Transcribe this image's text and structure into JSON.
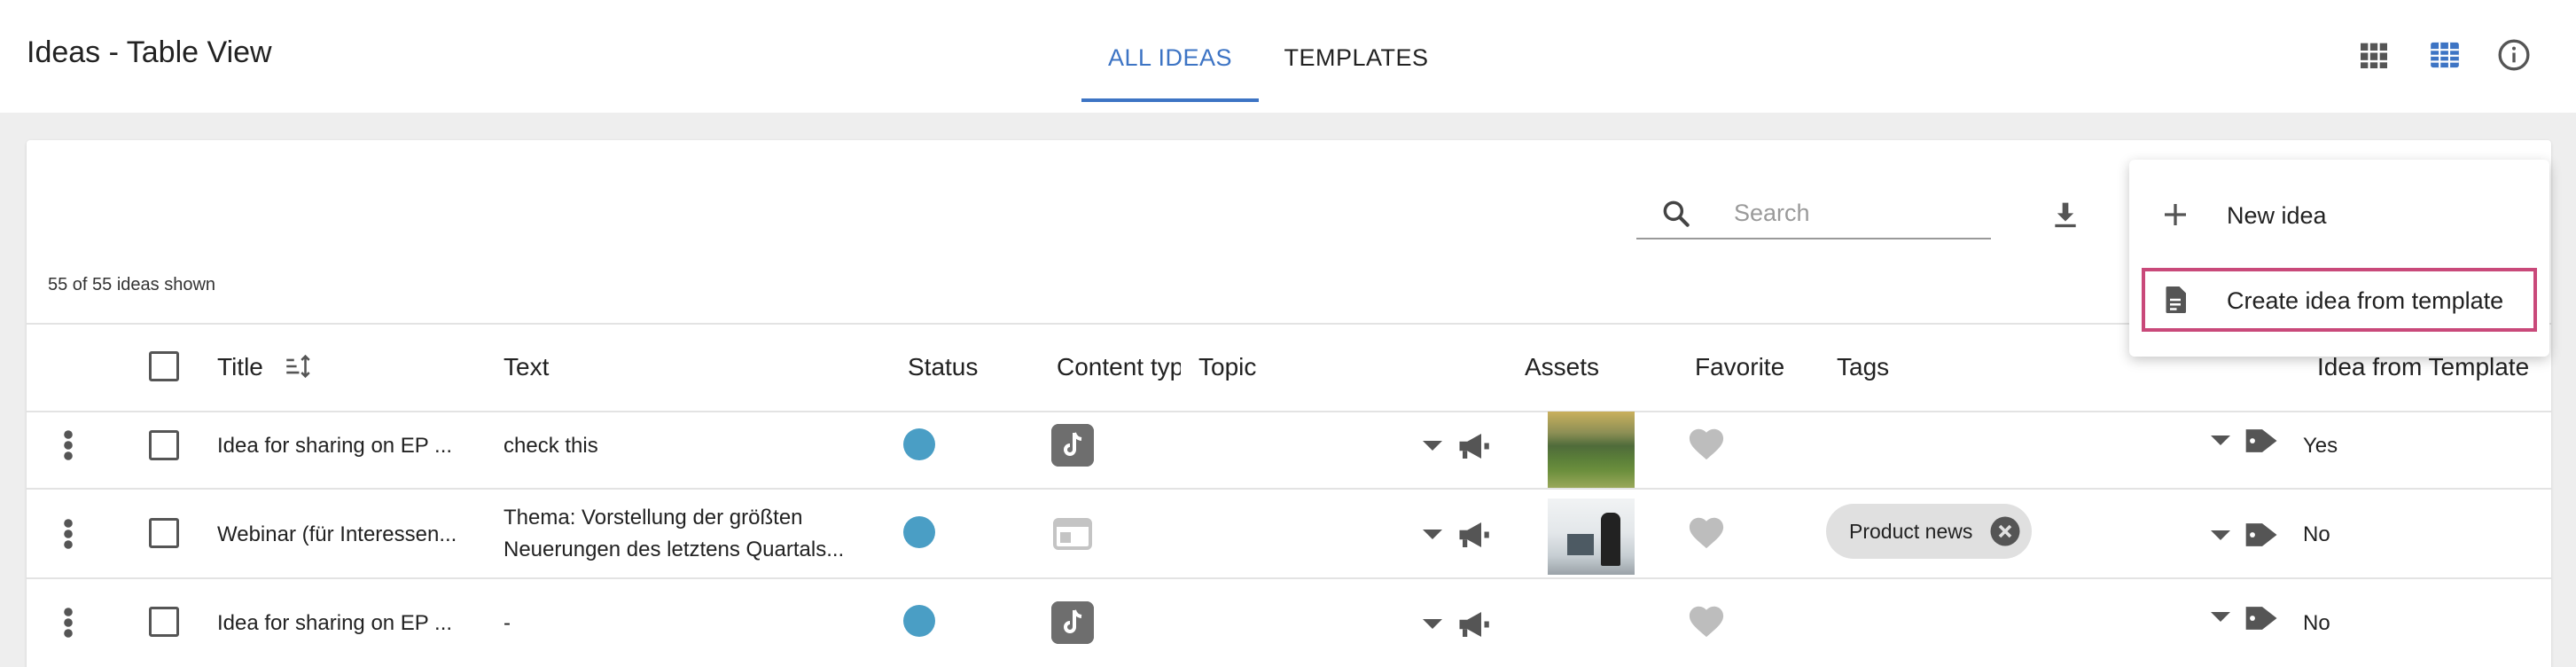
{
  "app": {
    "title": "Ideas - Table View"
  },
  "tabs": [
    {
      "label": "ALL IDEAS",
      "active": true
    },
    {
      "label": "TEMPLATES",
      "active": false
    }
  ],
  "header_icons": [
    "grid-view-icon",
    "table-view-icon",
    "info-icon"
  ],
  "colors": {
    "accent": "#3d74c4",
    "status_blue": "#4a9ec5",
    "highlight": "#c9497a"
  },
  "search": {
    "placeholder": "Search"
  },
  "count_text": "55 of 55 ideas shown",
  "columns": {
    "title": "Title",
    "text": "Text",
    "status": "Status",
    "content_type": "Content typ",
    "topic": "Topic",
    "assets": "Assets",
    "favorite": "Favorite",
    "tags": "Tags",
    "idea_from_template": "Idea from Template"
  },
  "rows": [
    {
      "title": "Idea for sharing on EP ...",
      "text_line1": "check this",
      "text_line2": "",
      "content_type": "tiktok",
      "asset": "landscape",
      "tag": "",
      "from_template": "Yes"
    },
    {
      "title": "Webinar (für Interessen...",
      "text_line1": "Thema: Vorstellung der größten",
      "text_line2": "Neuerungen des letztens Quartals...",
      "content_type": "web",
      "asset": "office",
      "tag": "Product news",
      "from_template": "No"
    },
    {
      "title": "Idea for sharing on EP ...",
      "text_line1": "-",
      "text_line2": "",
      "content_type": "tiktok",
      "asset": "",
      "tag": "",
      "from_template": "No"
    }
  ],
  "menu": {
    "new_idea": "New idea",
    "from_template": "Create idea from template"
  }
}
